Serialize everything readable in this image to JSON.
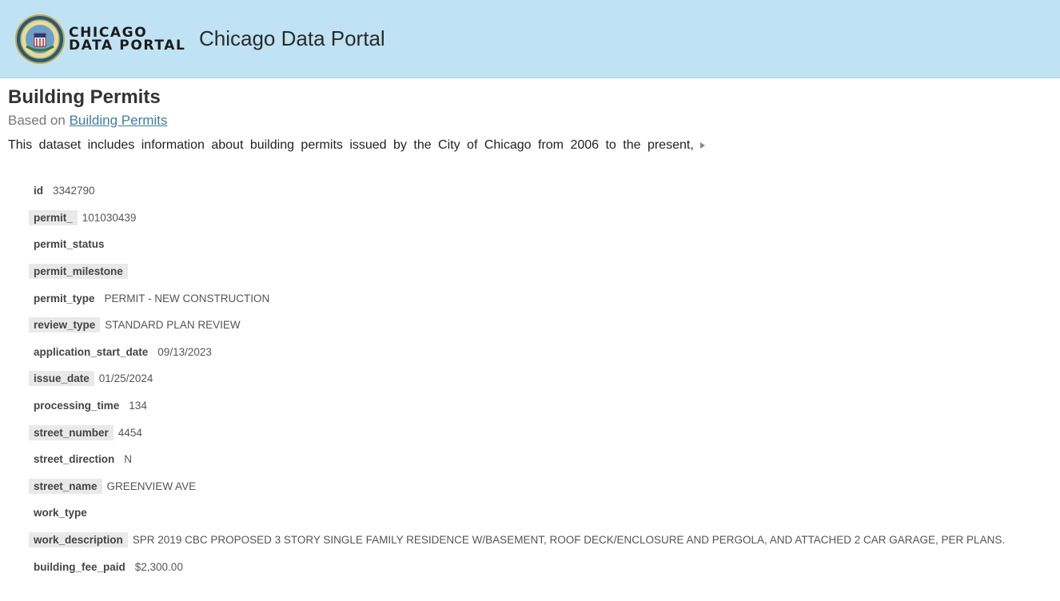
{
  "header": {
    "logo_line1": "CHICAGO",
    "logo_line2": "DATA PORTAL",
    "site_title": "Chicago Data Portal",
    "seal_icon": "city-of-chicago-seal-icon"
  },
  "main": {
    "title": "Building Permits",
    "based_on_prefix": "Based on",
    "based_on_link": "Building Permits",
    "description": "This dataset includes information about building permits issued by the City of Chicago from 2006 to the present,"
  },
  "fields": [
    {
      "name": "id",
      "value": "3342790"
    },
    {
      "name": "permit_",
      "value": "101030439"
    },
    {
      "name": "permit_status",
      "value": ""
    },
    {
      "name": "permit_milestone",
      "value": ""
    },
    {
      "name": "permit_type",
      "value": "PERMIT - NEW CONSTRUCTION"
    },
    {
      "name": "review_type",
      "value": "STANDARD PLAN REVIEW"
    },
    {
      "name": "application_start_date",
      "value": "09/13/2023"
    },
    {
      "name": "issue_date",
      "value": "01/25/2024"
    },
    {
      "name": "processing_time",
      "value": "134"
    },
    {
      "name": "street_number",
      "value": "4454"
    },
    {
      "name": "street_direction",
      "value": "N"
    },
    {
      "name": "street_name",
      "value": "GREENVIEW AVE"
    },
    {
      "name": "work_type",
      "value": ""
    },
    {
      "name": "work_description",
      "value": "SPR 2019 CBC PROPOSED 3 STORY SINGLE FAMILY RESIDENCE W/BASEMENT, ROOF DECK/ENCLOSURE AND PERGOLA, AND ATTACHED 2 CAR GARAGE, PER PLANS."
    },
    {
      "name": "building_fee_paid",
      "value": "$2,300.00"
    }
  ]
}
